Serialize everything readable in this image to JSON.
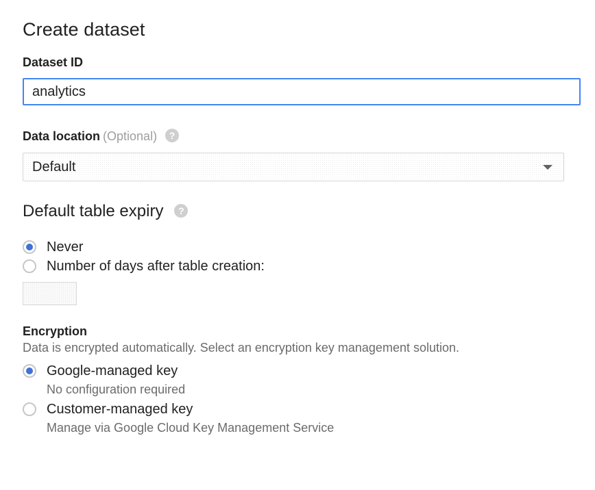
{
  "form": {
    "title": "Create dataset",
    "dataset_id": {
      "label": "Dataset ID",
      "value": "analytics"
    },
    "data_location": {
      "label": "Data location",
      "optional_text": "(Optional)",
      "help_icon": "help-circle-icon",
      "selected": "Default"
    },
    "table_expiry": {
      "title": "Default table expiry",
      "help_icon": "help-circle-icon",
      "options": [
        {
          "label": "Never",
          "checked": true
        },
        {
          "label": "Number of days after table creation:",
          "checked": false
        }
      ],
      "days_value": ""
    },
    "encryption": {
      "title": "Encryption",
      "description": "Data is encrypted automatically. Select an encryption key management solution.",
      "options": [
        {
          "label": "Google-managed key",
          "sublabel": "No configuration required",
          "checked": true
        },
        {
          "label": "Customer-managed key",
          "sublabel": "Manage via Google Cloud Key Management Service",
          "checked": false
        }
      ]
    }
  },
  "colors": {
    "accent": "#4285f4",
    "radio_dot": "#4071d7",
    "muted_text": "#6b6b6b"
  }
}
